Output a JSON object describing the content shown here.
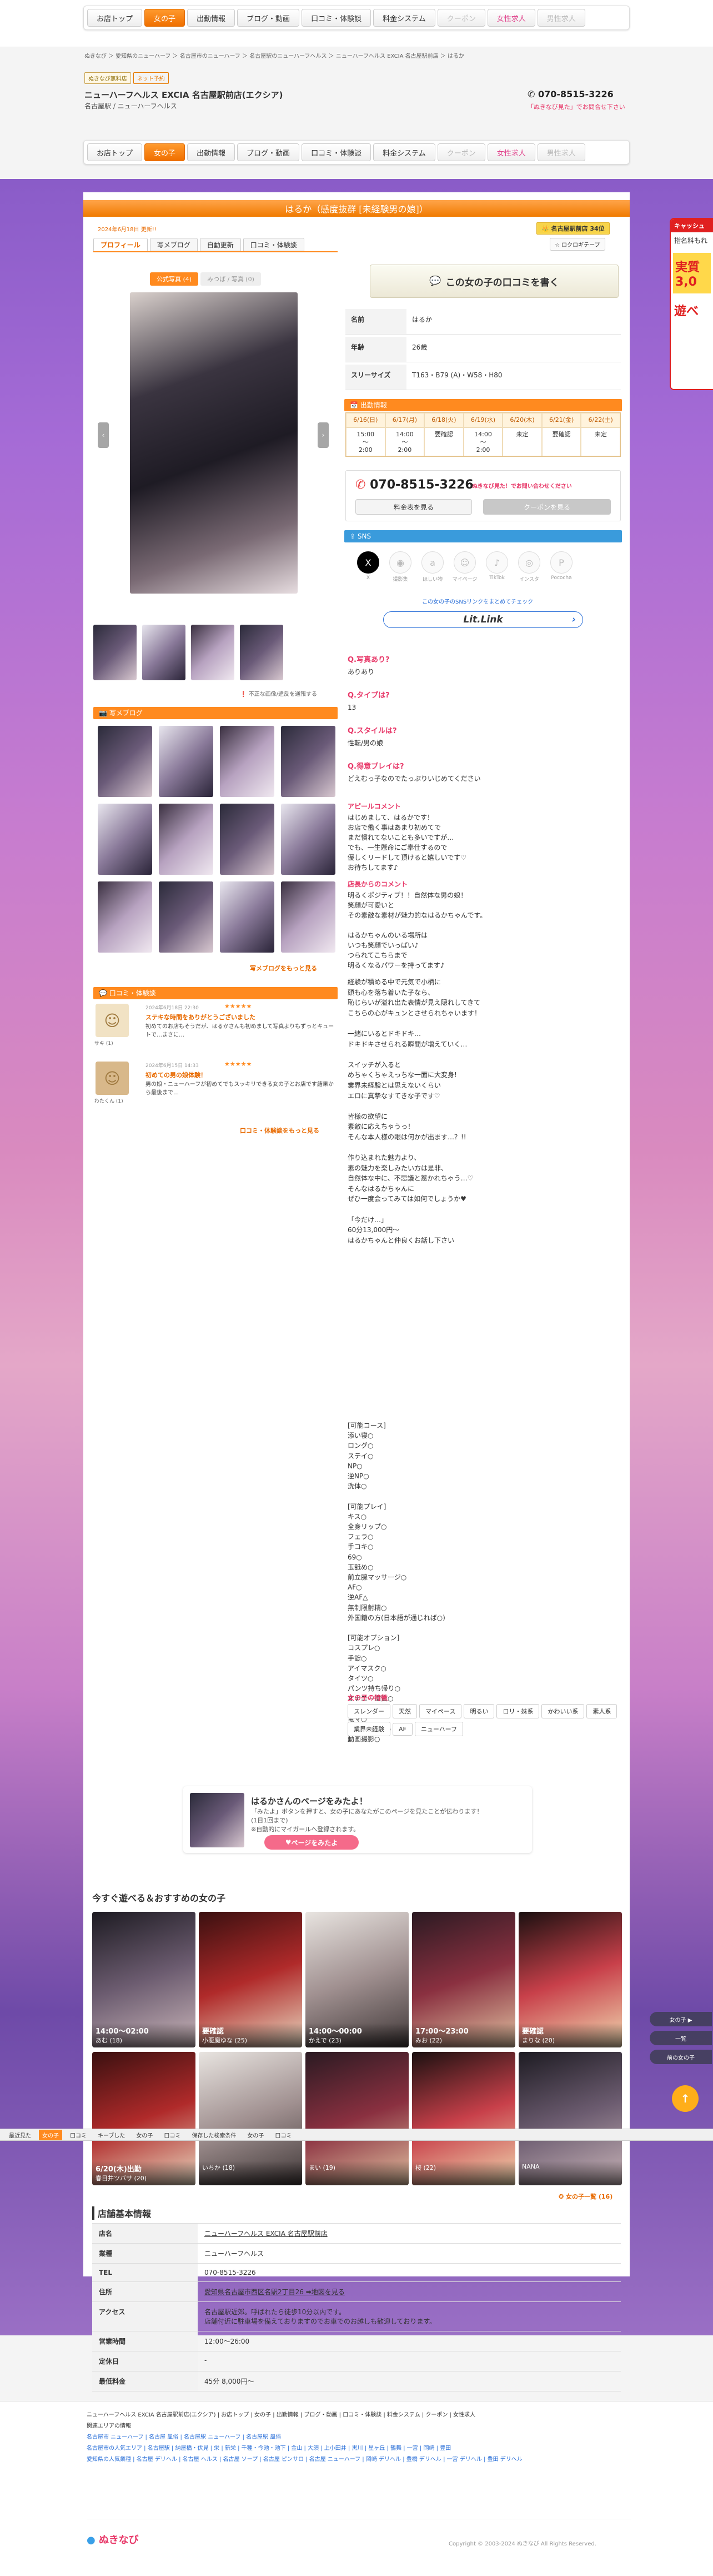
{
  "nav": {
    "items": [
      "お店トップ",
      "女の子",
      "出勤情報",
      "ブログ・動画",
      "口コミ・体験談",
      "料金システム",
      "クーポン",
      "女性求人",
      "男性求人"
    ],
    "active_index": 1
  },
  "breadcrumb": "ぬきなび ＞ 愛知県のニューハーフ ＞ 名古屋市のニューハーフ ＞ 名古屋駅のニューハーフヘルス ＞ ニューハーフヘルス EXCIA 名古屋駅前店 ＞ はるか",
  "shop": {
    "badge1": "ぬきなび無料店",
    "badge2": "ネット予約",
    "name": "ニューハーフヘルス EXCIA 名古屋駅前店(エクシア)",
    "sub": "名古屋駅 / ニューハーフヘルス",
    "phone": "070-8515-3226",
    "phone_note": "「ぬきなび見た」でお問合せ下さい"
  },
  "profile": {
    "title": "はるか（感度抜群 [未経験男の娘]）",
    "updated": "2024年6月18日 更新!!",
    "rank_badge": "名古屋駅前店 34位",
    "tabs": [
      "プロフィール",
      "写メブログ",
      "自動更新",
      "口コミ・体験談"
    ],
    "fav": "ロクロギテープ",
    "img_tabs": [
      "公式写真 (4)",
      "みつば / 写真 (0)"
    ],
    "photo_note": "不正な画像/違反を通報する"
  },
  "review_button": "この女の子の口コミを書く",
  "stats": [
    {
      "k": "名前",
      "v": "はるか"
    },
    {
      "k": "年齢",
      "v": "26歳"
    },
    {
      "k": "スリーサイズ",
      "v": "T163・B79 (A)・W58・H80"
    }
  ],
  "schedule": {
    "title": "出勤情報",
    "days": [
      "6/16(日)",
      "6/17(月)",
      "6/18(火)",
      "6/19(水)",
      "6/20(木)",
      "6/21(金)",
      "6/22(土)"
    ],
    "times": [
      "15:00\n〜\n2:00",
      "14:00\n〜\n2:00",
      "要確認",
      "14:00\n〜\n2:00",
      "未定",
      "要確認",
      "未定"
    ]
  },
  "call": {
    "phone": "070-8515-3226",
    "note": "ぬきなび見た！でお問い合わせください",
    "btn1": "料金表を見る",
    "btn2": "クーポンを見る"
  },
  "sns": {
    "title": "SNS",
    "items": [
      "X",
      "撮影集",
      "ほしい物",
      "マイページ",
      "TikTok",
      "インスタ",
      "Pococha"
    ],
    "link_text": "この女の子のSNSリンクをまとめてチェック",
    "lit": "Lit.Link"
  },
  "qa": [
    {
      "q": "Q.写真あり?",
      "a": "ありあり"
    },
    {
      "q": "Q.タイプは?",
      "a": "13"
    },
    {
      "q": "Q.スタイルは?",
      "a": "性転/男の娘"
    },
    {
      "q": "Q.得意プレイは?",
      "a": "どえむっ子なのでたっぷりいじめてください"
    }
  ],
  "appeal": {
    "title": "アピールコメント",
    "text": "はじめまして、はるかです！\nお店で働く事はあまり初めてで\nまだ慣れてないことも多いですが…\nでも、一生懸命にご奉仕するので\n優しくリードして頂けると嬉しいです♡\nお待ちしてます♪"
  },
  "shop_comment": {
    "title": "店長からのコメント",
    "text": "明るくポジティブ！！自然体な男の娘！\n笑顔が可愛いと\nその素敵な素材が魅力的なはるかちゃんです。\n\nはるかちゃんのいる場所は\nいつも笑顔でいっぱい♪\nつられてこちらまで\n明るくなるパワーを持ってます♪"
  },
  "long_text": "経験が積める中で元気で小柄に\n頭も心を落ち着いた子なら、\n恥じらいが溢れ出た表情が見え隠れしてきて\nこちらの心がキュンとさせられちゃいます！\n\n一緒にいるとドキドキ…\nドキドキさせられる瞬間が増えていく…\n\nスイッチが入ると\nめちゃくちゃえっちな一面に大変身!\n業界未経験とは思えないくらい\nエロに真摯なすてきな子です♡\n\n皆様の欲望に\n素敵に応えちゃうっ！\nそんな本人様の眼は何かが出ます…？!!\n\n作り込まれた魅力より、\n素の魅力を楽しみたい方は是非、\n自然体な中に、不思議と惹かれちゃう…♡\nそんなはるかちゃんに\nぜひ一度会ってみては如何でしょうか♥\n\n「今だけ…」\n60分13,000円〜\nはるかちゃんと仲良くお話し下さい",
  "options_text": "[可能コース]\n添い寝○\nロング○\nステイ○\nNP○\n逆NP○\n洗体○\n\n[可能プレイ]\nキス○\n全身リップ○\nフェラ○\n手コキ○\n69○\n玉舐め○\n前立腺マッサージ○\nAF○\n逆AF△\n無制限射精○\n外国籍の方(日本語が通じれば○)\n\n[可能オプション]\nコスプレ○\n手錠○\nアイマスク○\nタイツ○\nパンツ持ち帰り○\nオナニー鑑賞○\n目隠し○\n電マ○\n写真撮影5枚○\n動画撮影○",
  "features": {
    "title": "女の子の特徴",
    "tags": [
      "スレンダー",
      "天然",
      "マイペース",
      "明るい",
      "ロリ・妹系",
      "かわいい系",
      "素人系",
      "業界未経験",
      "AF",
      "ニューハーフ"
    ]
  },
  "blog": {
    "title": "写メブログ",
    "more": "写メブログをもっと見る"
  },
  "reviews": {
    "title": "口コミ・体験談",
    "items": [
      {
        "date": "2024年6月18日 22:30",
        "title": "ステキな時間をありがとうございました",
        "text": "初めてのお店もそうだが、はるかさんも初めまして写真よりもずっとキュートで…まさに…",
        "user": "サキ (1)"
      },
      {
        "date": "2024年6月15日 14:33",
        "title": "初めての男の娘体験！",
        "text": "男の娘・ニューハーフが初めてでもスッキリできる女の子とお店です結果から最後まで…",
        "user": "わたくん (1)"
      }
    ],
    "more": "口コミ・体験談をもっと見る"
  },
  "promo": {
    "title": "はるかさんのページをみたよ！",
    "text": "「みたよ」ボタンを押すと、女の子にあなたがこのページを見たことが伝わります！\n(1日1回まで)\n※自動的にマイガールへ登録されます。",
    "btn": "ページをみたよ"
  },
  "recommend": {
    "title": "今すぐ遊べる＆おすすめの女の子",
    "row1": [
      {
        "time": "14:00〜02:00",
        "name": "あむ (18)"
      },
      {
        "time": "要確認",
        "name": "小悪魔ゆな (25)"
      },
      {
        "time": "14:00〜00:00",
        "name": "かえで (23)"
      },
      {
        "time": "17:00〜23:00",
        "name": "みお (22)"
      },
      {
        "time": "要確認",
        "name": "まりな (20)"
      }
    ],
    "row2": [
      {
        "time": "6/20(木)出勤",
        "name": "春日井ツバサ (20)"
      },
      {
        "time": "",
        "name": "いちか (18)"
      },
      {
        "time": "",
        "name": "まい (19)"
      },
      {
        "time": "",
        "name": "桜 (22)"
      },
      {
        "time": "",
        "name": "NANA"
      }
    ],
    "more": "女の子一覧 (16)"
  },
  "shopinfo": {
    "title": "店舗基本情報",
    "rows": [
      {
        "k": "店名",
        "v": "ニューハーフヘルス EXCIA 名古屋駅前店"
      },
      {
        "k": "業種",
        "v": "ニューハーフヘルス"
      },
      {
        "k": "TEL",
        "v": "070-8515-3226"
      },
      {
        "k": "住所",
        "v": "愛知県名古屋市西区名駅2丁目26 ➡地図を見る"
      },
      {
        "k": "アクセス",
        "v": "名古屋駅近郊。呼ばれたら徒歩10分以内です。\n店舗付近に駐車場を備えておりますのでお車でのお越しも歓迎しております。"
      },
      {
        "k": "営業時間",
        "v": "12:00〜26:00"
      },
      {
        "k": "定休日",
        "v": "-"
      },
      {
        "k": "最低料金",
        "v": "45分 8,000円〜"
      }
    ]
  },
  "side_ad": {
    "head": "キャッシュ",
    "t1": "指名料もれ",
    "t2": "実質3,0",
    "t3": "遊べ"
  },
  "float_btns": [
    "女の子 ▶",
    "一覧",
    "前の女の子"
  ],
  "bottom_bar": {
    "items": [
      "最近見た",
      "女の子",
      "口コミ",
      "キーブした",
      "女の子",
      "口コミ",
      "保存した検索条件",
      "女の子",
      "口コミ"
    ]
  },
  "footer": {
    "crumb": "ニューハーフヘルス EXCIA 名古屋駅前店(エクシア) | お店トップ | 女の子 | 出勤情報 | ブログ・動画 | 口コミ・体験談 | 料金システム | クーポン | 女性求人",
    "area_title": "関連エリアの情報",
    "line1": "名古屋市 ニューハーフ | 名古屋 風俗 | 名古屋駅 ニューハーフ | 名古屋駅 風俗",
    "line2": "名古屋市の人気エリア | 名古屋駅 | 納屋橋・伏見 | 栄 | 新栄 | 千種・今池・池下 | 金山 | 大須 | 上小田井 | 黒川 | 星ヶ丘 | 鶴舞 | 一宮 | 岡崎 | 豊田",
    "line3": "愛知県の人気業種 | 名古屋 デリヘル | 名古屋 ヘルス | 名古屋 ソープ | 名古屋 ピンサロ | 名古屋 ニューハーフ | 岡崎 デリヘル | 豊橋 デリヘル | 一宮 デリヘル | 豊田 デリヘル",
    "logo": "ぬきなび",
    "copyright": "Copyright © 2003-2024 ぬきなび All Rights Reserved."
  }
}
